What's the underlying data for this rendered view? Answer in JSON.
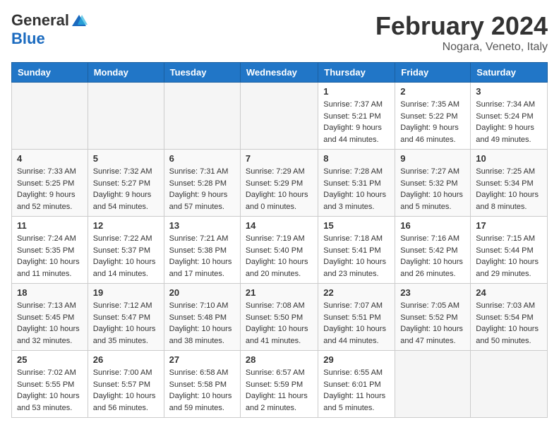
{
  "header": {
    "logo_general": "General",
    "logo_blue": "Blue",
    "month_title": "February 2024",
    "location": "Nogara, Veneto, Italy"
  },
  "weekdays": [
    "Sunday",
    "Monday",
    "Tuesday",
    "Wednesday",
    "Thursday",
    "Friday",
    "Saturday"
  ],
  "weeks": [
    [
      {
        "day": "",
        "info": ""
      },
      {
        "day": "",
        "info": ""
      },
      {
        "day": "",
        "info": ""
      },
      {
        "day": "",
        "info": ""
      },
      {
        "day": "1",
        "info": "Sunrise: 7:37 AM\nSunset: 5:21 PM\nDaylight: 9 hours and 44 minutes."
      },
      {
        "day": "2",
        "info": "Sunrise: 7:35 AM\nSunset: 5:22 PM\nDaylight: 9 hours and 46 minutes."
      },
      {
        "day": "3",
        "info": "Sunrise: 7:34 AM\nSunset: 5:24 PM\nDaylight: 9 hours and 49 minutes."
      }
    ],
    [
      {
        "day": "4",
        "info": "Sunrise: 7:33 AM\nSunset: 5:25 PM\nDaylight: 9 hours and 52 minutes."
      },
      {
        "day": "5",
        "info": "Sunrise: 7:32 AM\nSunset: 5:27 PM\nDaylight: 9 hours and 54 minutes."
      },
      {
        "day": "6",
        "info": "Sunrise: 7:31 AM\nSunset: 5:28 PM\nDaylight: 9 hours and 57 minutes."
      },
      {
        "day": "7",
        "info": "Sunrise: 7:29 AM\nSunset: 5:29 PM\nDaylight: 10 hours and 0 minutes."
      },
      {
        "day": "8",
        "info": "Sunrise: 7:28 AM\nSunset: 5:31 PM\nDaylight: 10 hours and 3 minutes."
      },
      {
        "day": "9",
        "info": "Sunrise: 7:27 AM\nSunset: 5:32 PM\nDaylight: 10 hours and 5 minutes."
      },
      {
        "day": "10",
        "info": "Sunrise: 7:25 AM\nSunset: 5:34 PM\nDaylight: 10 hours and 8 minutes."
      }
    ],
    [
      {
        "day": "11",
        "info": "Sunrise: 7:24 AM\nSunset: 5:35 PM\nDaylight: 10 hours and 11 minutes."
      },
      {
        "day": "12",
        "info": "Sunrise: 7:22 AM\nSunset: 5:37 PM\nDaylight: 10 hours and 14 minutes."
      },
      {
        "day": "13",
        "info": "Sunrise: 7:21 AM\nSunset: 5:38 PM\nDaylight: 10 hours and 17 minutes."
      },
      {
        "day": "14",
        "info": "Sunrise: 7:19 AM\nSunset: 5:40 PM\nDaylight: 10 hours and 20 minutes."
      },
      {
        "day": "15",
        "info": "Sunrise: 7:18 AM\nSunset: 5:41 PM\nDaylight: 10 hours and 23 minutes."
      },
      {
        "day": "16",
        "info": "Sunrise: 7:16 AM\nSunset: 5:42 PM\nDaylight: 10 hours and 26 minutes."
      },
      {
        "day": "17",
        "info": "Sunrise: 7:15 AM\nSunset: 5:44 PM\nDaylight: 10 hours and 29 minutes."
      }
    ],
    [
      {
        "day": "18",
        "info": "Sunrise: 7:13 AM\nSunset: 5:45 PM\nDaylight: 10 hours and 32 minutes."
      },
      {
        "day": "19",
        "info": "Sunrise: 7:12 AM\nSunset: 5:47 PM\nDaylight: 10 hours and 35 minutes."
      },
      {
        "day": "20",
        "info": "Sunrise: 7:10 AM\nSunset: 5:48 PM\nDaylight: 10 hours and 38 minutes."
      },
      {
        "day": "21",
        "info": "Sunrise: 7:08 AM\nSunset: 5:50 PM\nDaylight: 10 hours and 41 minutes."
      },
      {
        "day": "22",
        "info": "Sunrise: 7:07 AM\nSunset: 5:51 PM\nDaylight: 10 hours and 44 minutes."
      },
      {
        "day": "23",
        "info": "Sunrise: 7:05 AM\nSunset: 5:52 PM\nDaylight: 10 hours and 47 minutes."
      },
      {
        "day": "24",
        "info": "Sunrise: 7:03 AM\nSunset: 5:54 PM\nDaylight: 10 hours and 50 minutes."
      }
    ],
    [
      {
        "day": "25",
        "info": "Sunrise: 7:02 AM\nSunset: 5:55 PM\nDaylight: 10 hours and 53 minutes."
      },
      {
        "day": "26",
        "info": "Sunrise: 7:00 AM\nSunset: 5:57 PM\nDaylight: 10 hours and 56 minutes."
      },
      {
        "day": "27",
        "info": "Sunrise: 6:58 AM\nSunset: 5:58 PM\nDaylight: 10 hours and 59 minutes."
      },
      {
        "day": "28",
        "info": "Sunrise: 6:57 AM\nSunset: 5:59 PM\nDaylight: 11 hours and 2 minutes."
      },
      {
        "day": "29",
        "info": "Sunrise: 6:55 AM\nSunset: 6:01 PM\nDaylight: 11 hours and 5 minutes."
      },
      {
        "day": "",
        "info": ""
      },
      {
        "day": "",
        "info": ""
      }
    ]
  ]
}
